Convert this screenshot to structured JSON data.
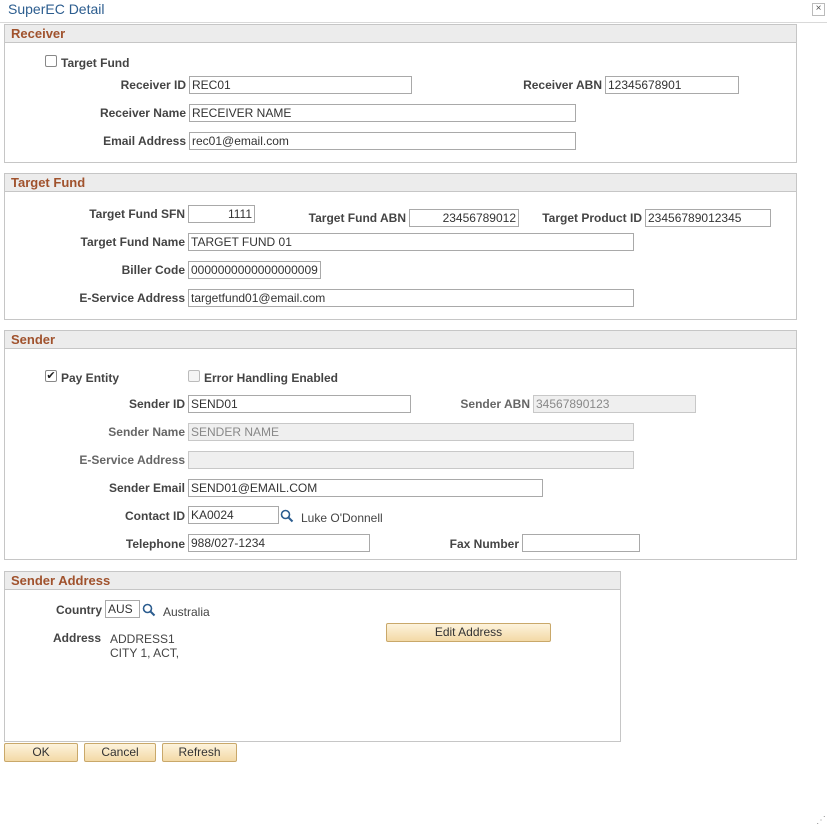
{
  "window": {
    "title": "SuperEC Detail",
    "close_glyph": "×"
  },
  "receiver": {
    "header": "Receiver",
    "target_fund_label": "Target Fund",
    "target_fund_checked": false,
    "receiver_id_label": "Receiver ID",
    "receiver_id": "REC01",
    "receiver_abn_label": "Receiver ABN",
    "receiver_abn": "12345678901",
    "receiver_name_label": "Receiver Name",
    "receiver_name": "RECEIVER NAME",
    "email_label": "Email Address",
    "email": "rec01@email.com"
  },
  "target_fund": {
    "header": "Target Fund",
    "sfn_label": "Target Fund SFN",
    "sfn": "1111",
    "abn_label": "Target Fund ABN",
    "abn": "23456789012",
    "product_id_label": "Target Product ID",
    "product_id": "23456789012345",
    "name_label": "Target Fund Name",
    "name": "TARGET FUND 01",
    "biller_code_label": "Biller Code",
    "biller_code": "0000000000000000009",
    "eservice_label": "E-Service Address",
    "eservice": "targetfund01@email.com"
  },
  "sender": {
    "header": "Sender",
    "pay_entity_label": "Pay Entity",
    "pay_entity_checked": true,
    "error_handling_label": "Error Handling Enabled",
    "error_handling_checked": false,
    "sender_id_label": "Sender ID",
    "sender_id": "SEND01",
    "sender_abn_label": "Sender ABN",
    "sender_abn": "34567890123",
    "sender_name_label": "Sender Name",
    "sender_name": "SENDER NAME",
    "eservice_label": "E-Service Address",
    "eservice": "",
    "sender_email_label": "Sender Email",
    "sender_email": "SEND01@EMAIL.COM",
    "contact_id_label": "Contact ID",
    "contact_id": "KA0024",
    "contact_name": "Luke O'Donnell",
    "telephone_label": "Telephone",
    "telephone": "988/027-1234",
    "fax_label": "Fax Number",
    "fax": ""
  },
  "sender_address": {
    "header": "Sender Address",
    "country_label": "Country",
    "country_code": "AUS",
    "country_name": "Australia",
    "address_label": "Address",
    "address_line1": "ADDRESS1",
    "address_line2": "CITY 1, ACT,",
    "edit_button": "Edit Address"
  },
  "footer": {
    "ok": "OK",
    "cancel": "Cancel",
    "refresh": "Refresh"
  },
  "icons": {
    "checkmark": "✔",
    "resize": "⋰"
  }
}
